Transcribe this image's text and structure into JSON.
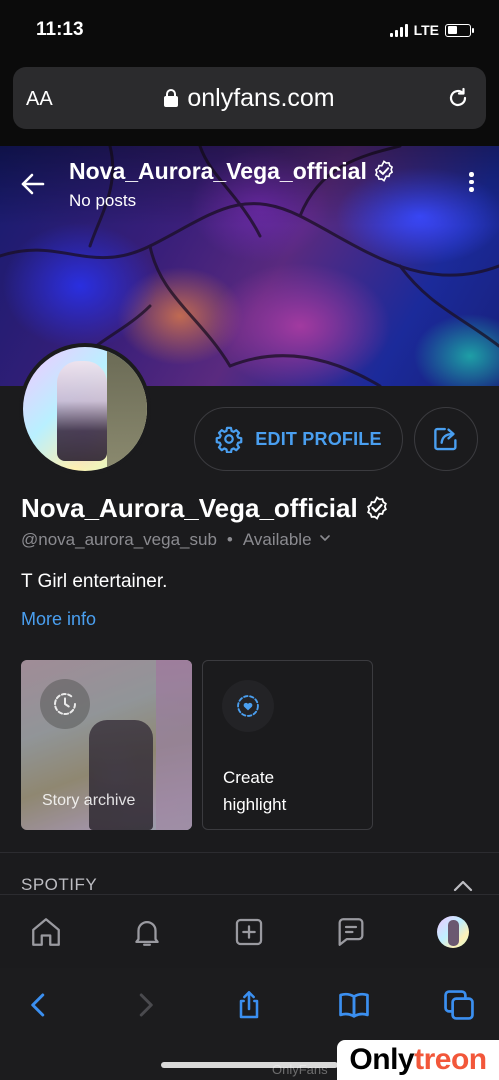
{
  "status_bar": {
    "time": "11:13",
    "network": "LTE",
    "battery_level": 0.45
  },
  "browser": {
    "aa_label": "AA",
    "url": "onlyfans.com"
  },
  "cover": {
    "title": "Nova_Aurora_Vega_official",
    "subtitle": "No posts"
  },
  "profile": {
    "name": "Nova_Aurora_Vega_official",
    "handle": "@nova_aurora_vega_sub",
    "separator": "•",
    "status": "Available",
    "bio": "T Girl entertainer.",
    "more_info": "More info",
    "edit_profile": "EDIT PROFILE"
  },
  "stories": {
    "archive_label": "Story archive",
    "create_line1": "Create",
    "create_line2": "highlight"
  },
  "sections": {
    "spotify": "SPOTIFY"
  },
  "watermark": {
    "small": "OnlyFans",
    "brand_part1": "Only",
    "brand_part2": "treon"
  },
  "colors": {
    "accent": "#4a9ff0",
    "background": "#1b1b1d",
    "watermark_orange": "#f2573a"
  }
}
